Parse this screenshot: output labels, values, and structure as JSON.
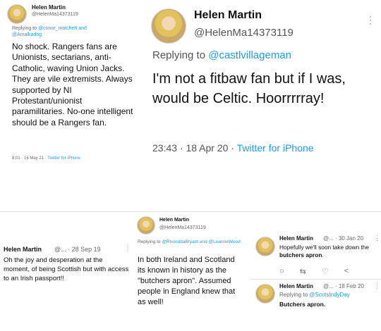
{
  "tweet1": {
    "name": "Helen Martin",
    "handle": "@HelenMa14373119",
    "replying_prefix": "Replying to ",
    "replying_to": "@conor_matchett and @Amalkadog",
    "body": "No shock. Rangers fans are Unionists, sectarians, anti- Catholic, waving Union Jacks. They are vile extremists. Always supported by NI Protestant/unionist paramilitaries. No-one intelligent should be a Rangers fan.",
    "timestamp": "8:01 · 16 May 21 · ",
    "source": "Twitter for iPhone"
  },
  "tweet2": {
    "name": "Helen Martin",
    "handle": "@HelenMa14373119",
    "replying_prefix": "Replying to ",
    "replying_to": "@castlvillageman",
    "body": "I'm not a fitbaw fan but if I was, would be Celtic. Hoorrrrray!",
    "timestamp": "23:43 · 18 Apr 20 · ",
    "source": "Twitter for iPhone",
    "more": "⋮"
  },
  "tweet3": {
    "name": "Helen Martin",
    "handle_date": "@... · 28 Sep 19",
    "more": "⋮",
    "body": "Oh the joy and desperation at the moment, of being Scottish but with access to an Irish passport!!"
  },
  "tweet4": {
    "name": "Helen Martin",
    "handle": "@HelenMa14373119",
    "replying_prefix": "Replying to ",
    "replying_to": "@RhonddaBryant and @LeanneWood",
    "body": "In both Ireland and Scotland its known in history as the \"butchers apron\". Assumed people in England knew that as well!"
  },
  "tweet5": {
    "name": "Helen Martin",
    "handle_date": "@... · 30 Jan 20",
    "more": "⋮",
    "body_prefix": "Hopefully we'll soon take down the ",
    "body_bold": "butchers apron",
    "body_suffix": ".",
    "icons": [
      "reply-icon",
      "retweet-icon",
      "like-icon",
      "share-icon"
    ],
    "icon_glyphs": [
      "○",
      "⇆",
      "♡",
      "<"
    ]
  },
  "tweet6": {
    "name": "Helen Martin",
    "handle_date": "@... · 18 Feb 20",
    "more": "⋮",
    "replying_prefix": "Replying to ",
    "replying_to": "@ScotsIndyDay",
    "body": "Butchers apron."
  }
}
